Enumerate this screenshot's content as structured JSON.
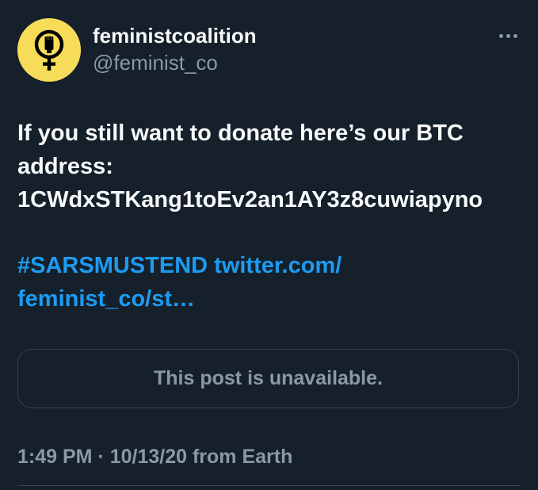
{
  "author": {
    "display_name": "feministcoalition",
    "handle": "@feminist_co",
    "avatar_icon": "feminist-fist-symbol-icon",
    "avatar_bg": "#f7dc59"
  },
  "more_icon": "more-horizontal-icon",
  "tweet": {
    "text_lines": [
      "If you still want to donate here’s our BTC",
      "address:",
      "1CWdxSTKang1toEv2an1AY3z8cuwiapyno"
    ],
    "hashtag": "#SARSMUSTEND",
    "link_part1": "twitter.com/",
    "link_part2": "feminist_co/st…"
  },
  "quoted_post": {
    "message": "This post is unavailable."
  },
  "meta": {
    "timestamp": "1:49 PM · 10/13/20 from Earth"
  },
  "colors": {
    "background": "#15202b",
    "primary_text": "#f7f9f9",
    "secondary_text": "#8b98a5",
    "link": "#1d9bf0",
    "border": "#38444d"
  }
}
